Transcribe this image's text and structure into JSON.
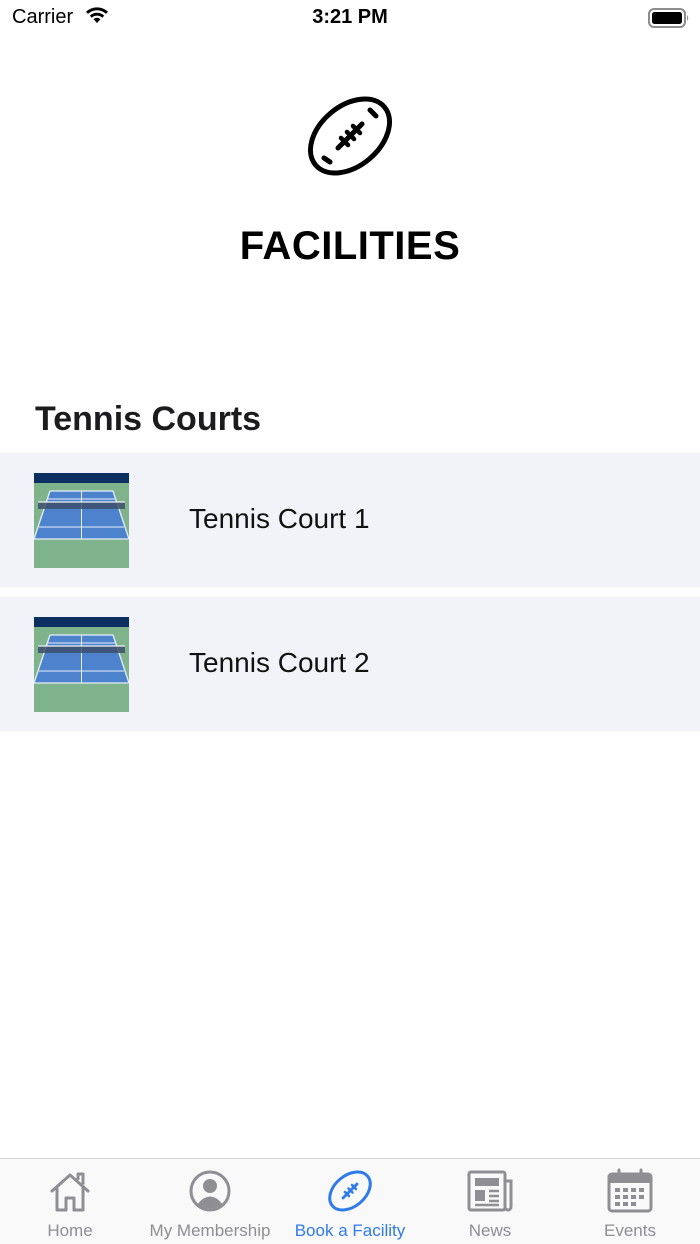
{
  "status_bar": {
    "carrier": "Carrier",
    "time": "3:21 PM"
  },
  "header": {
    "title": "FACILITIES",
    "icon": "football-icon"
  },
  "section": {
    "title": "Tennis Courts"
  },
  "facilities": [
    {
      "name": "Tennis Court 1",
      "image": "tennis-court-thumbnail"
    },
    {
      "name": "Tennis Court 2",
      "image": "tennis-court-thumbnail"
    }
  ],
  "tabs": [
    {
      "label": "Home",
      "icon": "home-icon",
      "active": false
    },
    {
      "label": "My Membership",
      "icon": "profile-icon",
      "active": false
    },
    {
      "label": "Book a Facility",
      "icon": "football-icon",
      "active": true
    },
    {
      "label": "News",
      "icon": "newspaper-icon",
      "active": false
    },
    {
      "label": "Events",
      "icon": "calendar-icon",
      "active": false
    }
  ],
  "colors": {
    "accent": "#2f7bea",
    "inactive": "#8e8e93",
    "row_background": "#f1f3f8"
  }
}
